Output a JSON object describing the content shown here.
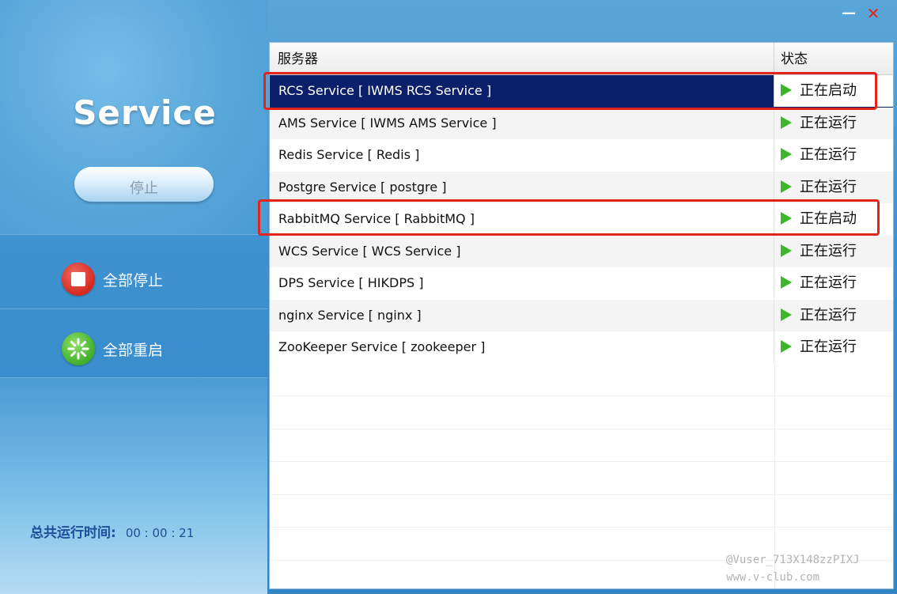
{
  "window": {
    "minimize_glyph": "—",
    "close_glyph": "✕"
  },
  "left": {
    "title": "Service",
    "stop_button_label": "停止",
    "stop_all_label": "全部停止",
    "restart_all_label": "全部重启",
    "uptime_label": "总共运行时间:",
    "uptime_value": "00 : 00 : 21"
  },
  "table": {
    "columns": [
      "服务器",
      "状态"
    ],
    "rows": [
      {
        "name": "RCS Service [ IWMS RCS Service ]",
        "status": "正在启动",
        "selected": true
      },
      {
        "name": "AMS Service [ IWMS AMS Service ]",
        "status": "正在运行",
        "selected": false
      },
      {
        "name": "Redis Service [ Redis ]",
        "status": "正在运行",
        "selected": false
      },
      {
        "name": "Postgre Service [ postgre ]",
        "status": "正在运行",
        "selected": false
      },
      {
        "name": "RabbitMQ Service [ RabbitMQ ]",
        "status": "正在启动",
        "selected": false
      },
      {
        "name": "WCS Service [ WCS Service ]",
        "status": "正在运行",
        "selected": false
      },
      {
        "name": "DPS Service [ HIKDPS ]",
        "status": "正在运行",
        "selected": false
      },
      {
        "name": "nginx Service [ nginx ]",
        "status": "正在运行",
        "selected": false
      },
      {
        "name": "ZooKeeper Service [ zookeeper ]",
        "status": "正在运行",
        "selected": false
      }
    ],
    "empty_rows": 7
  },
  "icons": {
    "stop_all": "stop-square-icon",
    "restart_all": "restart-spinner-icon",
    "status": "play-triangle-icon"
  },
  "colors": {
    "selected_row": "#0b1f6b",
    "status_play": "#3cb72a",
    "annotation": "#e3241c",
    "stop_icon": "#d4291f",
    "restart_icon": "#3fae2a"
  },
  "watermark": {
    "line1": "@Vuser_713X148zzPIXJ",
    "line2": "www.v-club.com"
  }
}
